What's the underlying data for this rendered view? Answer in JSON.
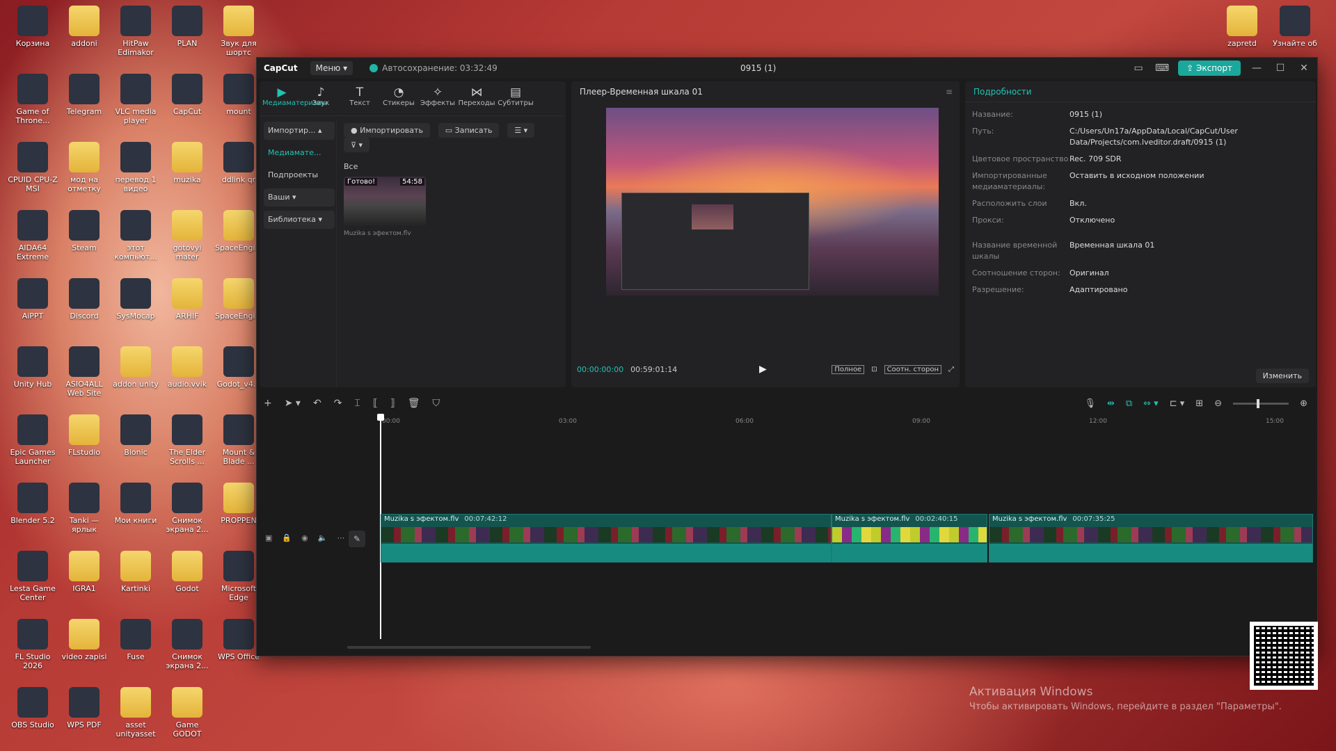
{
  "desktop": {
    "col1": [
      "Корзина",
      "Game of Throne...",
      "CPUID CPU-Z MSI",
      "AIDA64 Extreme",
      "AiPPT",
      "Unity Hub",
      "Epic Games Launcher",
      "Blender 5.2",
      "Lesta Game Center",
      "FL Studio 2026",
      "OBS Studio"
    ],
    "col2": [
      "addoni",
      "Telegram",
      "мод на отметку",
      "Steam",
      "Discord",
      "ASIO4ALL Web Site",
      "FLstudio",
      "Tanki — ярлык",
      "IGRA1",
      "video zapisi",
      "WPS PDF"
    ],
    "col3": [
      "HitPaw Edimakor",
      "VLC media player",
      "перевод 1 видео",
      "этот компьют...",
      "SysMocap",
      "addon unity",
      "Bionic",
      "Мои книги",
      "Kartinki",
      "Fuse",
      "asset unityasset"
    ],
    "col4": [
      "PLAN",
      "CapCut",
      "muzika",
      "gotovyi mater",
      "ARHIF",
      "audio.vvik",
      "The Elder Scrolls ...",
      "Снимок экрана 2...",
      "Godot",
      "Снимок экрана 2...",
      "Game GODOT"
    ],
    "col5": [
      "Звук для шортс",
      "mount",
      "ddlink qr",
      "SpaceEngi...",
      "SpaceEngi...",
      "Godot_v4...",
      "Mount & Blade ...",
      "PROPPEN",
      "Microsoft Edge",
      "WPS Office"
    ],
    "right": [
      "zapretd",
      "Узнайте об"
    ]
  },
  "window": {
    "logo": "CapCut",
    "menu": "Меню",
    "autosave": "Автосохранение: 03:32:49",
    "project_title": "0915 (1)",
    "export": "Экспорт"
  },
  "media": {
    "tabs": [
      {
        "label": "Медиаматериалы",
        "icon": "▶"
      },
      {
        "label": "Звук",
        "icon": "♪"
      },
      {
        "label": "Текст",
        "icon": "T"
      },
      {
        "label": "Стикеры",
        "icon": "◔"
      },
      {
        "label": "Эффекты",
        "icon": "✧"
      },
      {
        "label": "Переходы",
        "icon": "⋈"
      },
      {
        "label": "Субтитры",
        "icon": "▤"
      }
    ],
    "nav": [
      "Импортир...",
      "Медиамате...",
      "Подпроекты",
      "Ваши",
      "Библиотека"
    ],
    "import_btn": "Импортировать",
    "record_btn": "Записать",
    "all_label": "Все",
    "clip_status": "Готово!",
    "clip_duration": "54:58",
    "clip_name": "Muzika s эфектом.flv"
  },
  "player": {
    "title": "Плеер-Временная шкала 01",
    "current_time": "00:00:00:00",
    "duration": "00:59:01:14",
    "full_label": "Полное",
    "ratio_label": "Соотн. сторон"
  },
  "details": {
    "title": "Подробности",
    "rows": [
      {
        "k": "Название:",
        "v": "0915 (1)"
      },
      {
        "k": "Путь:",
        "v": "C:/Users/Un17a/AppData/Local/CapCut/User Data/Projects/com.lveditor.draft/0915 (1)"
      },
      {
        "k": "Цветовое пространство",
        "v": "Rec. 709 SDR"
      },
      {
        "k": "Импортированные медиаматериалы:",
        "v": "Оставить в исходном положении"
      },
      {
        "k": "Расположить слои",
        "v": "Вкл."
      },
      {
        "k": "Прокси:",
        "v": "Отключено"
      },
      {
        "k": "Название временной шкалы",
        "v": "Временная шкала 01"
      },
      {
        "k": "Соотношение сторон:",
        "v": "Оригинал"
      },
      {
        "k": "Разрешение:",
        "v": "Адаптировано"
      }
    ],
    "change_btn": "Изменить"
  },
  "timeline": {
    "ruler": [
      "00:00",
      "03:00",
      "06:00",
      "09:00",
      "12:00",
      "15:00"
    ],
    "clips": [
      {
        "name": "Muzika s эфектом.flv",
        "dur": "00:07:42:12"
      },
      {
        "name": "Muzika s эфектом.flv",
        "dur": "00:02:40:15"
      },
      {
        "name": "Muzika s эфектом.flv",
        "dur": "00:07:35:25"
      }
    ]
  },
  "activation": {
    "title": "Активация Windows",
    "text": "Чтобы активировать Windows, перейдите в раздел \"Параметры\"."
  }
}
